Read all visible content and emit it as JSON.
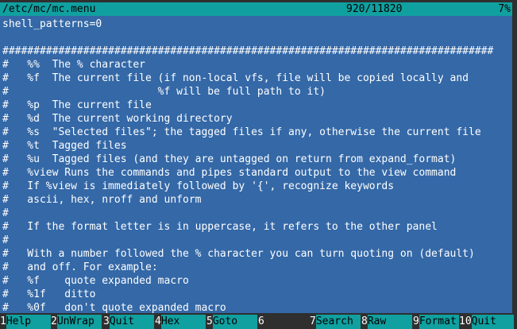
{
  "titlebar": {
    "path": "/etc/mc/mc.menu",
    "position": "920/11820",
    "percent": "7%"
  },
  "viewer": {
    "lines": [
      "shell_patterns=0",
      "",
      "###############################################################################",
      "#   %%  The % character",
      "#   %f  The current file (if non-local vfs, file will be copied locally and",
      "#                        %f will be full path to it)",
      "#   %p  The current file",
      "#   %d  The current working directory",
      "#   %s  \"Selected files\"; the tagged files if any, otherwise the current file",
      "#   %t  Tagged files",
      "#   %u  Tagged files (and they are untagged on return from expand_format)",
      "#   %view Runs the commands and pipes standard output to the view command",
      "#   If %view is immediately followed by '{', recognize keywords",
      "#   ascii, hex, nroff and unform",
      "#",
      "#   If the format letter is in uppercase, it refers to the other panel",
      "#",
      "#   With a number followed the % character you can turn quoting on (default)",
      "#   and off. For example:",
      "#   %f    quote expanded macro",
      "#   %1f   ditto",
      "#   %0f   don't quote expanded macro"
    ]
  },
  "fkeys": [
    {
      "num": "1",
      "label": "Help"
    },
    {
      "num": "2",
      "label": "UnWrap"
    },
    {
      "num": "3",
      "label": "Quit"
    },
    {
      "num": "4",
      "label": "Hex"
    },
    {
      "num": "5",
      "label": "Goto"
    },
    {
      "num": "6",
      "label": ""
    },
    {
      "num": "7",
      "label": "Search"
    },
    {
      "num": "8",
      "label": "Raw"
    },
    {
      "num": "9",
      "label": "Format"
    },
    {
      "num": "10",
      "label": "Quit"
    }
  ],
  "colors": {
    "background": "#3468a7",
    "bar": "#10a0a0",
    "text": "#ffffff",
    "bar_text": "#000000",
    "frame": "#2f2f2f"
  }
}
